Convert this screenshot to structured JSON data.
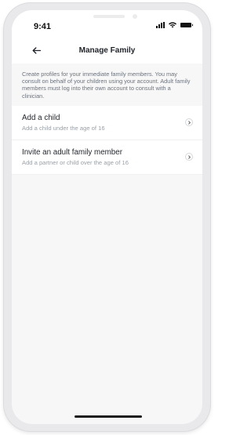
{
  "status": {
    "time": "9:41"
  },
  "header": {
    "title": "Manage Family",
    "back_icon": "arrow-left-icon"
  },
  "intro_text": "Create profiles for your immediate family members. You may consult on behalf of your children using your account. Adult family members must log into their own account to consult with a clinician.",
  "options": [
    {
      "title": "Add a child",
      "subtitle": "Add a child under the age of 16",
      "icon": "chevron-right-icon"
    },
    {
      "title": "Invite an adult family member",
      "subtitle": "Add a partner or child over the age of 16",
      "icon": "chevron-right-icon"
    }
  ],
  "colors": {
    "background": "#f7f7f8",
    "card": "#ffffff",
    "title_text": "#1f2329",
    "body_text": "#6c737c",
    "subtitle_text": "#9aa0a7"
  }
}
